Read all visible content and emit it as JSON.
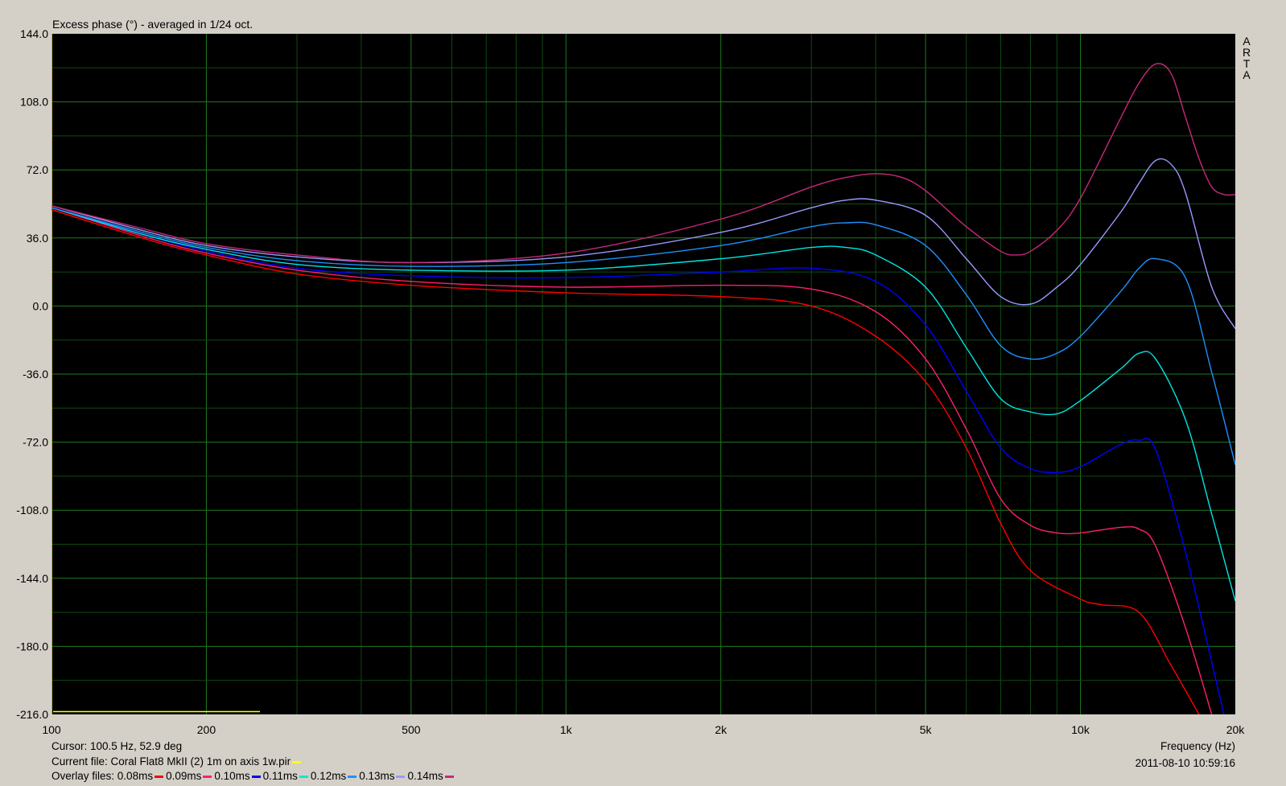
{
  "chart_data": {
    "type": "line",
    "title": "Excess phase (°) - averaged in 1/24 oct.",
    "xlabel": "Frequency (Hz)",
    "ylabel": "",
    "x_scale": "log",
    "xlim": [
      100,
      20000
    ],
    "ylim": [
      -216,
      144
    ],
    "grid": true,
    "yticks": [
      144,
      108,
      72,
      36,
      0,
      -36,
      -72,
      -108,
      -144,
      -180,
      -216
    ],
    "ytick_labels": [
      "144.0",
      "108.0",
      "72.0",
      "36.0",
      "0.0",
      "-36.0",
      "-72.0",
      "-108.0",
      "-144.0",
      "-180.0",
      "-216.0"
    ],
    "xticks": [
      100,
      200,
      500,
      1000,
      2000,
      5000,
      10000,
      20000
    ],
    "xtick_labels": [
      "100",
      "200",
      "500",
      "1k",
      "2k",
      "5k",
      "10k",
      "20k"
    ],
    "watermark": [
      "A",
      "R",
      "T",
      "A"
    ],
    "series": [
      {
        "name": "0.08ms",
        "color": "#ff0000",
        "x": [
          100,
          150,
          200,
          300,
          500,
          1000,
          2000,
          3000,
          4000,
          5000,
          6000,
          7000,
          8000,
          10000,
          11000,
          13000,
          15000,
          17000
        ],
        "y": [
          51,
          36,
          27,
          17,
          11,
          7,
          5,
          0,
          -16,
          -40,
          -75,
          -115,
          -140,
          -155,
          -158,
          -162,
          -190,
          -216
        ]
      },
      {
        "name": "0.09ms",
        "color": "#ff1f6e",
        "x": [
          100,
          150,
          200,
          300,
          500,
          1000,
          2000,
          3000,
          4000,
          5000,
          6000,
          7000,
          8000,
          9000,
          10000,
          12000,
          13000,
          14000,
          16000,
          18000
        ],
        "y": [
          52,
          37,
          28,
          19,
          13,
          10,
          11,
          9,
          -3,
          -28,
          -65,
          -102,
          -116,
          -120,
          -120,
          -117,
          -118,
          -127,
          -170,
          -216
        ]
      },
      {
        "name": "0.10ms",
        "color": "#0000ff",
        "x": [
          100,
          150,
          200,
          300,
          500,
          1000,
          2000,
          3000,
          4000,
          5000,
          6000,
          7000,
          8000,
          9000,
          10000,
          12000,
          13000,
          14000,
          16000,
          19000
        ],
        "y": [
          52,
          38,
          29,
          20,
          16,
          15,
          18,
          20,
          13,
          -10,
          -45,
          -75,
          -86,
          -88,
          -85,
          -73,
          -71,
          -76,
          -130,
          -216
        ]
      },
      {
        "name": "0.11ms",
        "color": "#00e5e5",
        "x": [
          100,
          150,
          200,
          300,
          500,
          1000,
          2000,
          3000,
          3500,
          4000,
          5000,
          6000,
          7000,
          8000,
          9000,
          10000,
          12000,
          13000,
          14000,
          16000,
          18000,
          20000
        ],
        "y": [
          52,
          38,
          30,
          22,
          19,
          19,
          25,
          31,
          31,
          27,
          10,
          -22,
          -49,
          -56,
          -57,
          -50,
          -33,
          -25,
          -28,
          -60,
          -110,
          -156
        ]
      },
      {
        "name": "0.12ms",
        "color": "#1e90ff",
        "x": [
          100,
          150,
          200,
          300,
          500,
          1000,
          2000,
          3000,
          3500,
          4000,
          5000,
          6000,
          7000,
          8000,
          9000,
          10000,
          12000,
          13000,
          14000,
          16000,
          18000,
          20000
        ],
        "y": [
          52,
          39,
          31,
          24,
          21,
          23,
          32,
          42,
          44,
          43,
          32,
          6,
          -21,
          -28,
          -25,
          -16,
          8,
          20,
          25,
          15,
          -35,
          -84
        ]
      },
      {
        "name": "0.13ms",
        "color": "#9999ff",
        "x": [
          100,
          150,
          200,
          300,
          500,
          1000,
          2000,
          3000,
          3500,
          4000,
          5000,
          6000,
          7000,
          8000,
          9000,
          10000,
          12000,
          13000,
          14000,
          15000,
          16000,
          18000,
          20000
        ],
        "y": [
          53,
          40,
          32,
          26,
          23,
          26,
          39,
          52,
          56,
          56,
          48,
          25,
          5,
          1,
          10,
          22,
          50,
          65,
          77,
          75,
          60,
          10,
          -12
        ]
      },
      {
        "name": "0.14ms",
        "color": "#c8287a",
        "x": [
          100,
          150,
          200,
          300,
          500,
          1000,
          2000,
          3000,
          3500,
          4000,
          4500,
          5000,
          6000,
          7000,
          7500,
          8000,
          9000,
          10000,
          12000,
          13000,
          14000,
          15000,
          16000,
          17000,
          18000,
          19000,
          20000
        ],
        "y": [
          53,
          41,
          33,
          27,
          23,
          28,
          46,
          63,
          68,
          70,
          68,
          61,
          42,
          29,
          27,
          29,
          40,
          57,
          100,
          118,
          128,
          123,
          100,
          78,
          63,
          59,
          59
        ]
      }
    ]
  },
  "footer": {
    "cursor": "Cursor: 100.5 Hz, 52.9 deg",
    "current_file_label": "Current file: Coral Flat8 MkII (2) 1m on axis 1w.pir",
    "current_file_color": "#ffff00",
    "overlay_label": "Overlay files:",
    "xlabel_right": "Frequency (Hz)",
    "timestamp": "2011-08-10  10:59:16"
  }
}
